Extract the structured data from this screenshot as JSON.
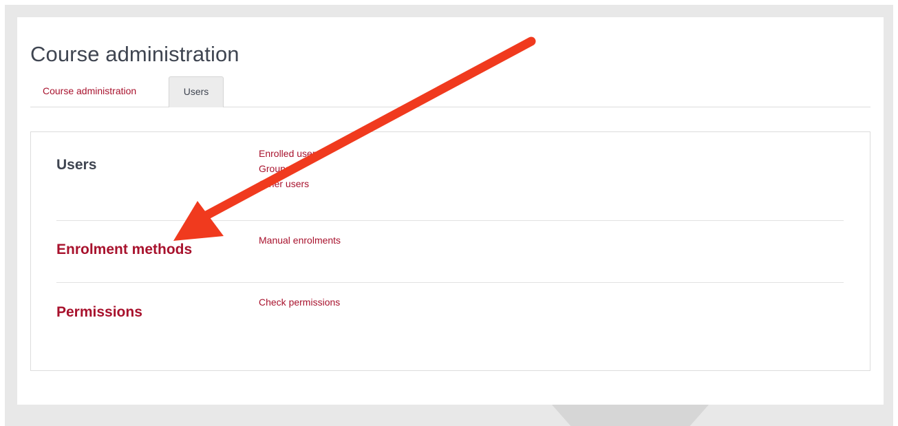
{
  "header": {
    "title": "Course administration"
  },
  "tabs": [
    {
      "label": "Course administration",
      "active": false
    },
    {
      "label": "Users",
      "active": true
    }
  ],
  "sections": [
    {
      "heading": "Users",
      "heading_is_link": false,
      "links": [
        "Enrolled users",
        "Groups",
        "Other users"
      ]
    },
    {
      "heading": "Enrolment methods",
      "heading_is_link": true,
      "links": [
        "Manual enrolments"
      ]
    },
    {
      "heading": "Permissions",
      "heading_is_link": true,
      "links": [
        "Check permissions"
      ]
    }
  ],
  "annotation": {
    "type": "arrow",
    "color": "#f03a1e",
    "points_to": "Enrolment methods"
  },
  "colors": {
    "link": "#a8122d",
    "text": "#3f4551",
    "background": "#e8e8e8"
  }
}
